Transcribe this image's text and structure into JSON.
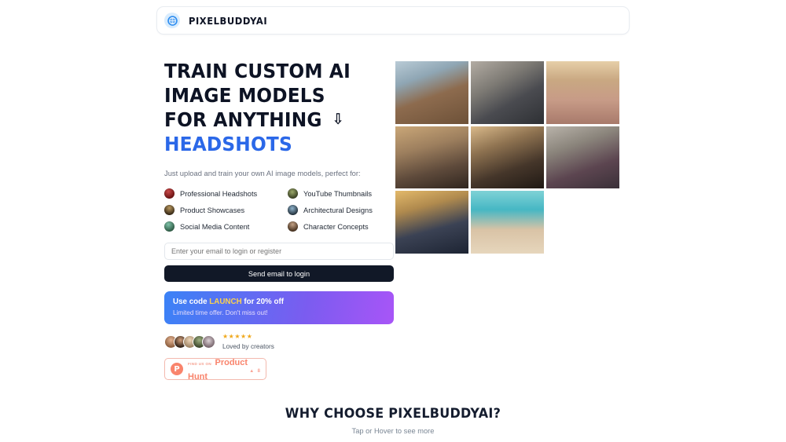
{
  "header": {
    "logo_icon": "globe-aperture-icon",
    "brand": "PIXELBUDDYAI"
  },
  "hero": {
    "headline_line1": "TRAIN CUSTOM AI",
    "headline_line2": "IMAGE MODELS",
    "headline_line3": "FOR ANYTHING",
    "headline_arrow": "⇩",
    "headline_accent": "HEADSHOTS",
    "accent_color": "#2b68e8",
    "subtitle": "Just upload and train your own AI image models, perfect for:",
    "features": [
      {
        "label": "Professional Headshots",
        "icon": "thumbnail-portrait-icon"
      },
      {
        "label": "YouTube Thumbnails",
        "icon": "thumbnail-portrait-icon"
      },
      {
        "label": "Product Showcases",
        "icon": "thumbnail-portrait-icon"
      },
      {
        "label": "Architectural Designs",
        "icon": "thumbnail-portrait-icon"
      },
      {
        "label": "Social Media Content",
        "icon": "thumbnail-portrait-icon"
      },
      {
        "label": "Character Concepts",
        "icon": "thumbnail-portrait-icon"
      }
    ],
    "email_placeholder": "Enter your email to login or register",
    "email_value": "",
    "login_button": "Send email to login"
  },
  "promo": {
    "prefix": "Use code ",
    "code": "LAUNCH",
    "suffix": " for 20% off",
    "code_color": "#fbd24e",
    "subtitle": "Limited time offer. Don't miss out!"
  },
  "social_proof": {
    "stars": "★★★★★",
    "star_color": "#f0a91e",
    "label": "Loved by creators",
    "avatar_count": 5
  },
  "product_hunt": {
    "logo_letter": "P",
    "pretext": "FIND US ON",
    "name": "Product Hunt",
    "caret": "▲",
    "votes": "8",
    "accent_color": "#f9846c"
  },
  "collage": {
    "tiles": [
      {
        "name": "woman-winter-coat-snow"
      },
      {
        "name": "man-grey-suit-street"
      },
      {
        "name": "woman-gown-ballroom"
      },
      {
        "name": "woman-sequin-dress-gala"
      },
      {
        "name": "woman-black-dress-dinner"
      },
      {
        "name": "man-tuxedo-portrait"
      },
      {
        "name": "woman-graduation-cap"
      },
      {
        "name": "woman-beach-swimwear"
      }
    ]
  },
  "why_section": {
    "title": "WHY CHOOSE PIXELBUDDYAI?",
    "subtitle": "Tap or Hover to see more"
  }
}
